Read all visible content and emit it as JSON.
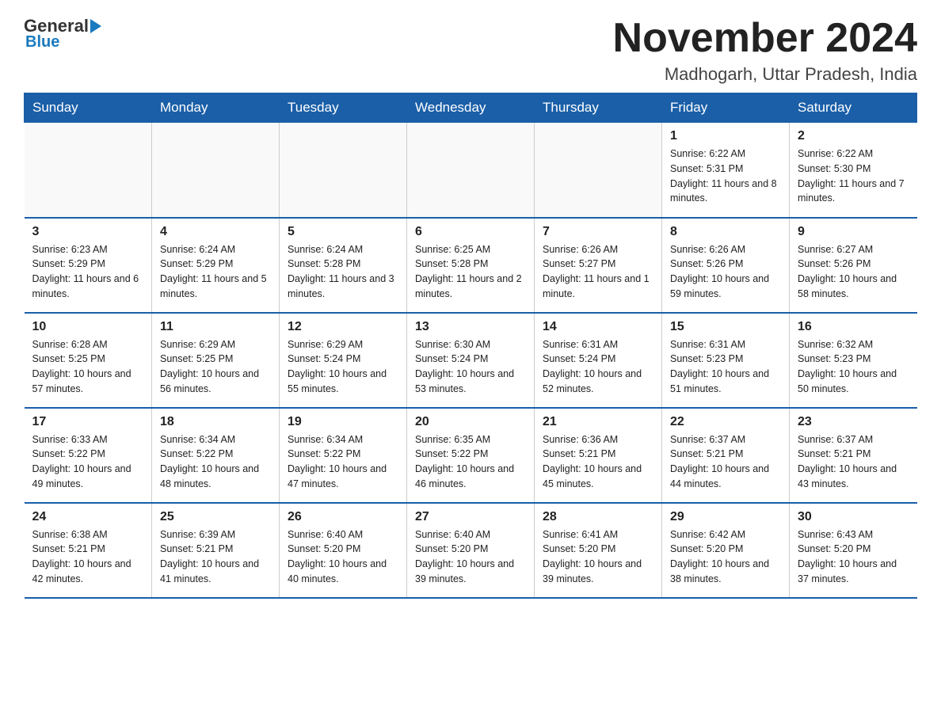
{
  "logo": {
    "text_general": "General",
    "text_blue": "Blue"
  },
  "title": "November 2024",
  "location": "Madhogarh, Uttar Pradesh, India",
  "weekdays": [
    "Sunday",
    "Monday",
    "Tuesday",
    "Wednesday",
    "Thursday",
    "Friday",
    "Saturday"
  ],
  "rows": [
    [
      {
        "day": "",
        "info": ""
      },
      {
        "day": "",
        "info": ""
      },
      {
        "day": "",
        "info": ""
      },
      {
        "day": "",
        "info": ""
      },
      {
        "day": "",
        "info": ""
      },
      {
        "day": "1",
        "info": "Sunrise: 6:22 AM\nSunset: 5:31 PM\nDaylight: 11 hours and 8 minutes."
      },
      {
        "day": "2",
        "info": "Sunrise: 6:22 AM\nSunset: 5:30 PM\nDaylight: 11 hours and 7 minutes."
      }
    ],
    [
      {
        "day": "3",
        "info": "Sunrise: 6:23 AM\nSunset: 5:29 PM\nDaylight: 11 hours and 6 minutes."
      },
      {
        "day": "4",
        "info": "Sunrise: 6:24 AM\nSunset: 5:29 PM\nDaylight: 11 hours and 5 minutes."
      },
      {
        "day": "5",
        "info": "Sunrise: 6:24 AM\nSunset: 5:28 PM\nDaylight: 11 hours and 3 minutes."
      },
      {
        "day": "6",
        "info": "Sunrise: 6:25 AM\nSunset: 5:28 PM\nDaylight: 11 hours and 2 minutes."
      },
      {
        "day": "7",
        "info": "Sunrise: 6:26 AM\nSunset: 5:27 PM\nDaylight: 11 hours and 1 minute."
      },
      {
        "day": "8",
        "info": "Sunrise: 6:26 AM\nSunset: 5:26 PM\nDaylight: 10 hours and 59 minutes."
      },
      {
        "day": "9",
        "info": "Sunrise: 6:27 AM\nSunset: 5:26 PM\nDaylight: 10 hours and 58 minutes."
      }
    ],
    [
      {
        "day": "10",
        "info": "Sunrise: 6:28 AM\nSunset: 5:25 PM\nDaylight: 10 hours and 57 minutes."
      },
      {
        "day": "11",
        "info": "Sunrise: 6:29 AM\nSunset: 5:25 PM\nDaylight: 10 hours and 56 minutes."
      },
      {
        "day": "12",
        "info": "Sunrise: 6:29 AM\nSunset: 5:24 PM\nDaylight: 10 hours and 55 minutes."
      },
      {
        "day": "13",
        "info": "Sunrise: 6:30 AM\nSunset: 5:24 PM\nDaylight: 10 hours and 53 minutes."
      },
      {
        "day": "14",
        "info": "Sunrise: 6:31 AM\nSunset: 5:24 PM\nDaylight: 10 hours and 52 minutes."
      },
      {
        "day": "15",
        "info": "Sunrise: 6:31 AM\nSunset: 5:23 PM\nDaylight: 10 hours and 51 minutes."
      },
      {
        "day": "16",
        "info": "Sunrise: 6:32 AM\nSunset: 5:23 PM\nDaylight: 10 hours and 50 minutes."
      }
    ],
    [
      {
        "day": "17",
        "info": "Sunrise: 6:33 AM\nSunset: 5:22 PM\nDaylight: 10 hours and 49 minutes."
      },
      {
        "day": "18",
        "info": "Sunrise: 6:34 AM\nSunset: 5:22 PM\nDaylight: 10 hours and 48 minutes."
      },
      {
        "day": "19",
        "info": "Sunrise: 6:34 AM\nSunset: 5:22 PM\nDaylight: 10 hours and 47 minutes."
      },
      {
        "day": "20",
        "info": "Sunrise: 6:35 AM\nSunset: 5:22 PM\nDaylight: 10 hours and 46 minutes."
      },
      {
        "day": "21",
        "info": "Sunrise: 6:36 AM\nSunset: 5:21 PM\nDaylight: 10 hours and 45 minutes."
      },
      {
        "day": "22",
        "info": "Sunrise: 6:37 AM\nSunset: 5:21 PM\nDaylight: 10 hours and 44 minutes."
      },
      {
        "day": "23",
        "info": "Sunrise: 6:37 AM\nSunset: 5:21 PM\nDaylight: 10 hours and 43 minutes."
      }
    ],
    [
      {
        "day": "24",
        "info": "Sunrise: 6:38 AM\nSunset: 5:21 PM\nDaylight: 10 hours and 42 minutes."
      },
      {
        "day": "25",
        "info": "Sunrise: 6:39 AM\nSunset: 5:21 PM\nDaylight: 10 hours and 41 minutes."
      },
      {
        "day": "26",
        "info": "Sunrise: 6:40 AM\nSunset: 5:20 PM\nDaylight: 10 hours and 40 minutes."
      },
      {
        "day": "27",
        "info": "Sunrise: 6:40 AM\nSunset: 5:20 PM\nDaylight: 10 hours and 39 minutes."
      },
      {
        "day": "28",
        "info": "Sunrise: 6:41 AM\nSunset: 5:20 PM\nDaylight: 10 hours and 39 minutes."
      },
      {
        "day": "29",
        "info": "Sunrise: 6:42 AM\nSunset: 5:20 PM\nDaylight: 10 hours and 38 minutes."
      },
      {
        "day": "30",
        "info": "Sunrise: 6:43 AM\nSunset: 5:20 PM\nDaylight: 10 hours and 37 minutes."
      }
    ]
  ]
}
